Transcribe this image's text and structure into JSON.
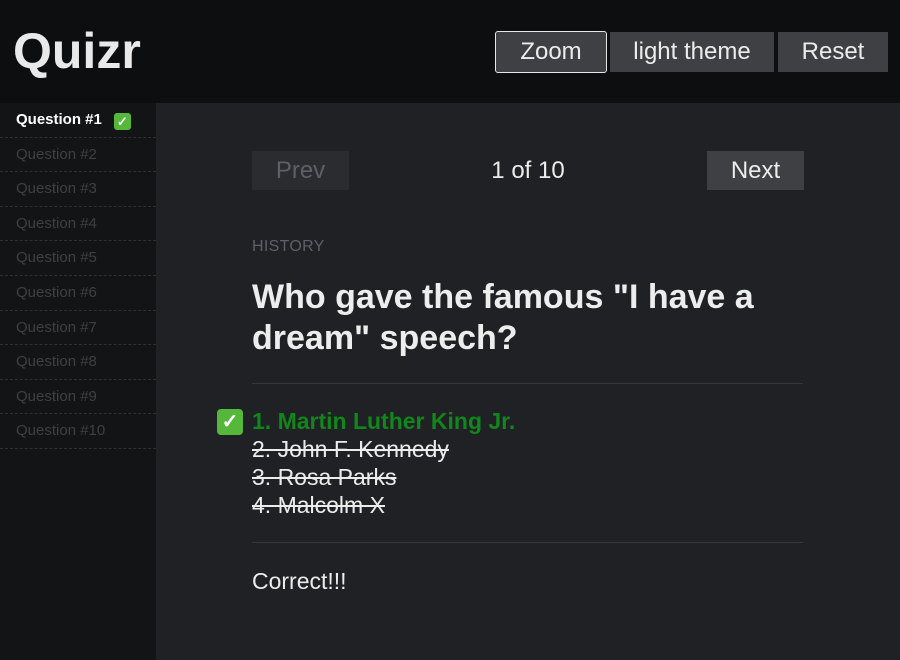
{
  "app": {
    "title": "Quizr"
  },
  "header": {
    "zoom_label": "Zoom",
    "theme_label": "light theme",
    "reset_label": "Reset"
  },
  "sidebar": {
    "items": [
      {
        "label": "Question #1",
        "answered": true,
        "status_icon": "check-icon"
      },
      {
        "label": "Question #2"
      },
      {
        "label": "Question #3"
      },
      {
        "label": "Question #4"
      },
      {
        "label": "Question #5"
      },
      {
        "label": "Question #6"
      },
      {
        "label": "Question #7"
      },
      {
        "label": "Question #8"
      },
      {
        "label": "Question #9"
      },
      {
        "label": "Question #10"
      }
    ]
  },
  "nav": {
    "prev_label": "Prev",
    "next_label": "Next",
    "counter": "1 of 10"
  },
  "question": {
    "category": "HISTORY",
    "text": "Who gave the famous \"I have a dream\" speech?",
    "answers": [
      {
        "label": "1. Martin Luther King Jr.",
        "correct": true
      },
      {
        "label": "2. John F. Kennedy",
        "correct": false
      },
      {
        "label": "3. Rosa Parks",
        "correct": false
      },
      {
        "label": "4. Malcolm X",
        "correct": false
      }
    ],
    "result": "Correct!!!"
  },
  "colors": {
    "correct": "#11861b",
    "check_badge": "#56b83a"
  }
}
